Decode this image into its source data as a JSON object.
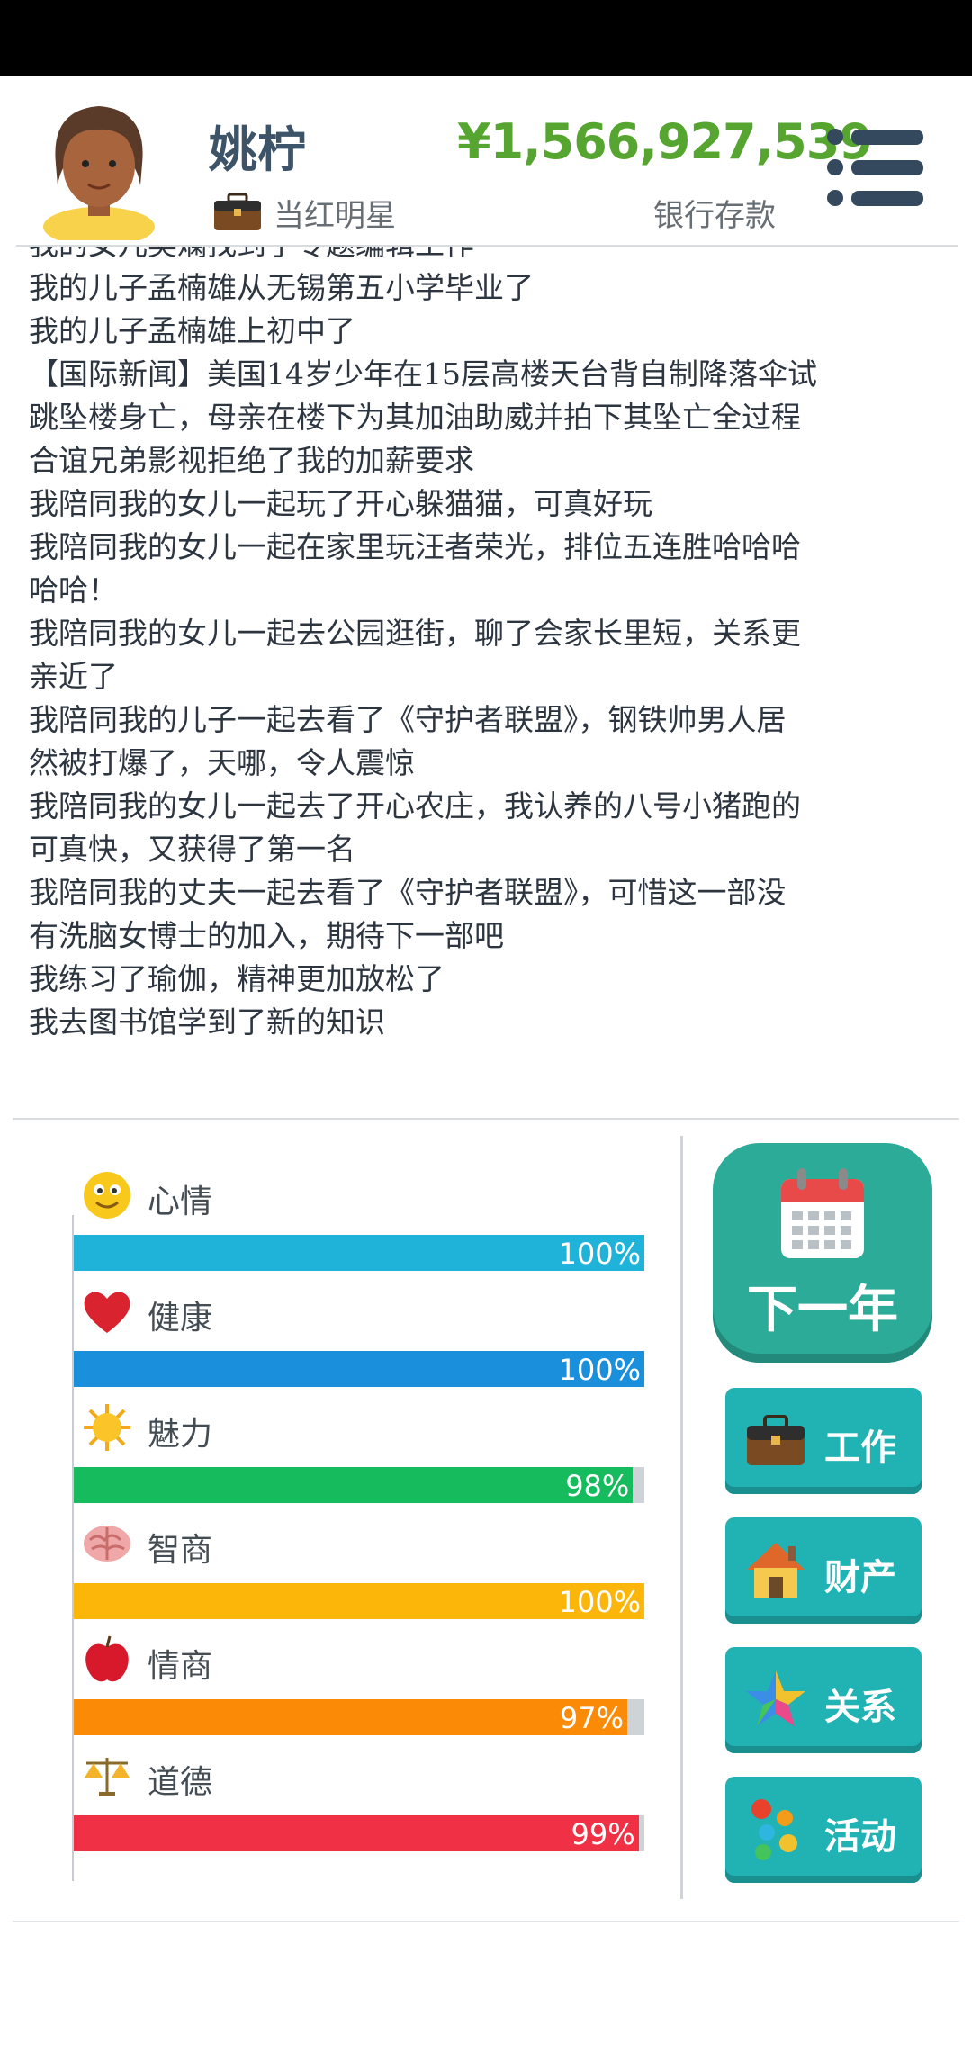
{
  "header": {
    "name": "姚柠",
    "career": "当红明星",
    "money": "¥1,566,927,539",
    "money_label": "银行存款",
    "avatar_icon": "female-avatar-icon",
    "career_icon": "briefcase-icon",
    "menu_icon": "menu-icon"
  },
  "log": [
    "我的女儿吴斓找到了专题编辑工作",
    "我的儿子孟楠雄从无锡第五小学毕业了",
    "我的儿子孟楠雄上初中了",
    "【国际新闻】美国14岁少年在15层高楼天台背自制降落伞试",
    "跳坠楼身亡，母亲在楼下为其加油助威并拍下其坠亡全过程",
    "合谊兄弟影视拒绝了我的加薪要求",
    "我陪同我的女儿一起玩了开心躲猫猫，可真好玩",
    "我陪同我的女儿一起在家里玩汪者荣光，排位五连胜哈哈哈",
    "哈哈！",
    "我陪同我的女儿一起去公园逛街，聊了会家长里短，关系更",
    "亲近了",
    "我陪同我的儿子一起去看了《守护者联盟》，钢铁帅男人居",
    "然被打爆了，天哪，令人震惊",
    "我陪同我的女儿一起去了开心农庄，我认养的八号小猪跑的",
    "可真快，又获得了第一名",
    "我陪同我的丈夫一起去看了《守护者联盟》，可惜这一部没",
    "有洗脑女博士的加入，期待下一部吧",
    "我练习了瑜伽，精神更加放松了",
    "我去图书馆学到了新的知识"
  ],
  "stats": [
    {
      "label": "心情",
      "value": 100,
      "display": "100%",
      "color": "#1fb3d9",
      "icon": "smiley-icon"
    },
    {
      "label": "健康",
      "value": 100,
      "display": "100%",
      "color": "#1a8fdc",
      "icon": "heart-icon"
    },
    {
      "label": "魅力",
      "value": 98,
      "display": "98%",
      "color": "#15bb5c",
      "icon": "sun-icon"
    },
    {
      "label": "智商",
      "value": 100,
      "display": "100%",
      "color": "#fbb609",
      "icon": "brain-icon"
    },
    {
      "label": "情商",
      "value": 97,
      "display": "97%",
      "color": "#fb8a07",
      "icon": "apple-icon"
    },
    {
      "label": "道德",
      "value": 99,
      "display": "99%",
      "color": "#ef3045",
      "icon": "scales-icon"
    }
  ],
  "actions": {
    "next_year": {
      "label": "下一年",
      "icon": "calendar-icon"
    },
    "work": {
      "label": "工作",
      "icon": "briefcase-icon"
    },
    "assets": {
      "label": "财产",
      "icon": "house-icon"
    },
    "relations": {
      "label": "关系",
      "icon": "star-icon"
    },
    "activities": {
      "label": "活动",
      "icon": "dots-icon"
    }
  },
  "colors": {
    "money": "#55a530",
    "button": "#21b3b4",
    "next_year_button": "#2cab98",
    "name": "#3d5468"
  }
}
